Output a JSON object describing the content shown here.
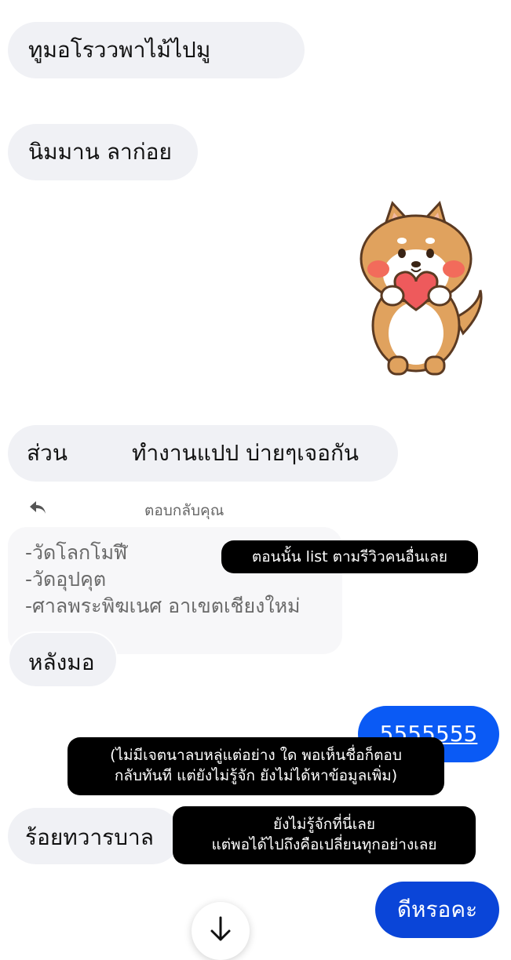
{
  "messages": {
    "m1": "ทูมอโรววพาไม้ไปมู",
    "m2": "นิมมาน ลาก่อย",
    "m3_left": "ส่วน",
    "m3_right": "ทำงานแปป บ่ายๆเจอกัน",
    "reply_label": "ตอบกลับคุณ",
    "quoted_lines": [
      "-วัดโลกโมฬี",
      "-วัดอุปคุต",
      "-ศาลพระพิฆเนศ อาเขตเชียงใหม่"
    ],
    "m4": "หลังมอ",
    "m5_out": "5555555",
    "m6": "ร้อยทวารบาล",
    "m7_out": "ดีหรอคะ"
  },
  "notes": {
    "n1": "ตอนนั้น list ตามรีวิวคนอื่นเลย",
    "n2_line1": "(ไม่มีเจตนาลบหลู่แต่อย่าง ใด พอเห็นชื่อก็ตอบ",
    "n2_line2": "กลับทันที แต่ยังไม่รู้จัก ยังไม่ได้หาข้อมูลเพิ่ม)",
    "n3_line1": "ยังไม่รู้จักที่นี่เลย",
    "n3_line2": "แต่พอได้ไปถึงคือเปลี่ยนทุกอย่างเลย"
  },
  "icons": {
    "reply": "reply-arrow-icon",
    "scroll_down": "arrow-down-icon",
    "sticker": "shiba-heart-sticker"
  },
  "colors": {
    "incoming_bubble": "#f0f1f5",
    "outgoing_bubble": "#0a5af5",
    "note_bg": "#000000"
  }
}
